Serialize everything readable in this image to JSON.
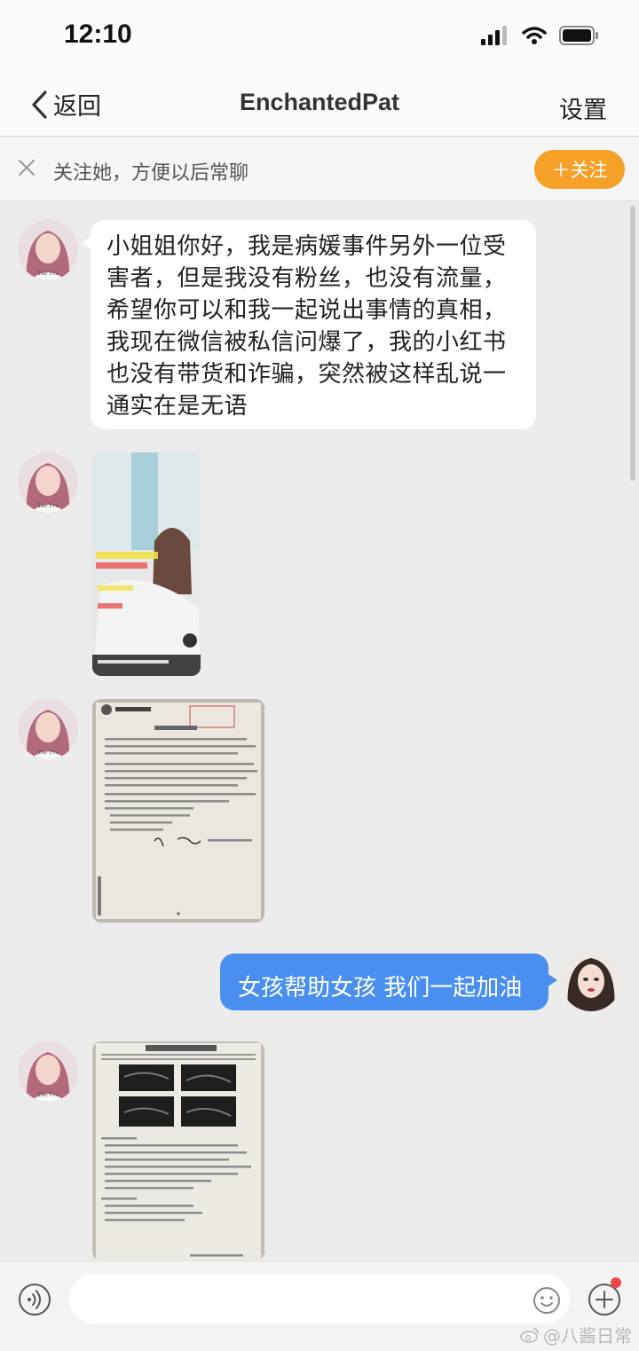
{
  "status_bar": {
    "time": "12:10"
  },
  "nav": {
    "back_label": "返回",
    "title": "EnchantedPat",
    "settings_label": "设置"
  },
  "follow_bar": {
    "prompt": "关注她，方便以后常聊",
    "follow_label": "＋关注"
  },
  "messages": [
    {
      "type": "text",
      "direction": "incoming",
      "text": "小姐姐你好，我是病媛事件另外一位受\n害者，但是我没有粉丝，也没有流量，\n希望你可以和我一起说出事情的真相，\n我现在微信被私信问爆了，我的小红书\n也没有带货和诈骗，突然被这样乱说一\n通实在是无语"
    },
    {
      "type": "image",
      "direction": "incoming",
      "description": "video screenshot"
    },
    {
      "type": "image",
      "direction": "incoming",
      "description": "medical record document photo"
    },
    {
      "type": "text",
      "direction": "outgoing",
      "text": "女孩帮助女孩 我们一起加油"
    },
    {
      "type": "image",
      "direction": "incoming",
      "description": "ultrasound report photo"
    }
  ],
  "input_bar": {
    "placeholder": ""
  },
  "watermark": {
    "text": "@八酱日常"
  },
  "colors": {
    "outgoing_bubble": "#4a8ef0",
    "follow_button": "#f5a026",
    "background": "#ececec"
  }
}
